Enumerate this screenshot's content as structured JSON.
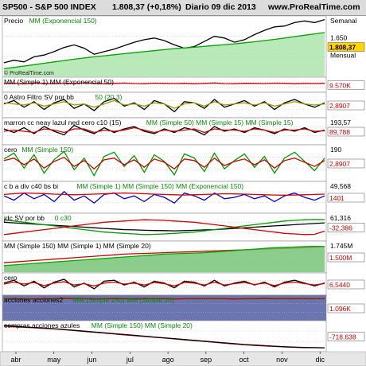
{
  "header": {
    "instrument": "SP500 - S&P 500 INDEX",
    "price": "1.808,37 (+0,18%)",
    "period": "Diario  09 dic 2013",
    "site": "www.ProRealTime.com"
  },
  "chart_data": {
    "type": "line",
    "x_axis": {
      "labels": [
        "abr",
        "may",
        "jun",
        "jul",
        "ago",
        "sep",
        "oct",
        "nov",
        "dic"
      ]
    },
    "panels": [
      {
        "id": "price",
        "title": "Precio",
        "title_extra": "MM (Exponencial 150)",
        "watermark": "© ProRealTime.com",
        "last_value": "1.808,37",
        "scale_labels": [
          "Semanal",
          "1.650",
          "Mensual"
        ],
        "y_range": [
          1480,
          1820
        ],
        "series": [
          {
            "color": "#000000",
            "values": [
              1555,
              1570,
              1560,
              1590,
              1600,
              1620,
              1645,
              1660,
              1640,
              1605,
              1620,
              1635,
              1655,
              1675,
              1690,
              1700,
              1685,
              1660,
              1640,
              1650,
              1680,
              1710,
              1700,
              1675,
              1690,
              1720,
              1745,
              1765,
              1770,
              1790,
              1800,
              1790,
              1808
            ]
          },
          {
            "color": "#00a000",
            "values": [
              1520,
              1528,
              1536,
              1544,
              1552,
              1560,
              1568,
              1576,
              1583,
              1590,
              1596,
              1602,
              1608,
              1614,
              1620,
              1626,
              1632,
              1638,
              1642,
              1646,
              1651,
              1656,
              1661,
              1666,
              1672,
              1678,
              1685,
              1692,
              1700,
              1708,
              1716,
              1724,
              1732
            ]
          }
        ]
      },
      {
        "id": "volume-ma",
        "title": "MM (Simple 1) MM (Exponencial 50)",
        "last_value": "9.570K",
        "y_range": [
          0,
          100
        ],
        "series": [
          {
            "color": "#cc0000",
            "values": [
              60,
              62,
              58,
              65,
              61,
              59,
              63,
              60,
              66,
              62,
              58,
              61,
              64,
              60,
              59,
              63,
              61,
              60,
              62,
              58,
              61,
              65,
              60,
              59,
              62,
              61,
              60,
              63,
              62,
              59,
              61,
              60,
              62
            ]
          }
        ]
      },
      {
        "id": "astro-filter",
        "title": "0 Astro Filtro SV por bb",
        "title_extra": "50 (20,3)",
        "last_value": "2,8907",
        "y_range": [
          -100,
          100
        ],
        "series": [
          {
            "color": "#000000",
            "values": [
              10,
              40,
              -20,
              30,
              -40,
              20,
              50,
              -30,
              10,
              -50,
              30,
              60,
              -10,
              20,
              -40,
              40,
              10,
              -60,
              30,
              20,
              -30,
              50,
              -20,
              10,
              40,
              -10,
              30,
              -40,
              20,
              50,
              10,
              -20,
              20
            ]
          },
          {
            "color": "#999900",
            "values": [
              20,
              10,
              0,
              20,
              -10,
              10,
              30,
              0,
              10,
              -20,
              10,
              40,
              0,
              10,
              -10,
              20,
              10,
              -30,
              10,
              20,
              -10,
              30,
              0,
              10,
              20,
              0,
              20,
              -10,
              10,
              30,
              10,
              0,
              10
            ]
          }
        ]
      },
      {
        "id": "oscillator-c10",
        "title": "marron cc neay lazul ned cero c10 (15)",
        "title_extra": "MM (Simple 50) MM (Simple 15) MM (Simple 15)",
        "scale_labels": [
          "193,57"
        ],
        "last_value": "89,788",
        "y_range": [
          0,
          200
        ],
        "series": [
          {
            "color": "#000000",
            "values": [
              120,
              90,
              130,
              80,
              140,
              100,
              70,
              150,
              110,
              80,
              130,
              90,
              120,
              140,
              100,
              80,
              120,
              90,
              130,
              110,
              70,
              140,
              100,
              120,
              90,
              130,
              110,
              80,
              120,
              100,
              130,
              90,
              110
            ]
          },
          {
            "color": "#cc0000",
            "values": [
              100,
              110,
              100,
              90,
              120,
              110,
              90,
              120,
              120,
              90,
              110,
              100,
              110,
              130,
              110,
              90,
              110,
              100,
              110,
              120,
              90,
              120,
              110,
              110,
              100,
              120,
              110,
              90,
              110,
              110,
              120,
              100,
              105
            ]
          }
        ]
      },
      {
        "id": "zero-line-osc",
        "title": "cero",
        "title_extra": "MM (Simple 150)",
        "scale_labels": [
          "190"
        ],
        "last_value": "2,8907",
        "y_range": [
          -200,
          200
        ],
        "series": [
          {
            "color": "#009900",
            "values": [
              50,
              120,
              -60,
              100,
              -120,
              40,
              140,
              -80,
              60,
              -150,
              80,
              130,
              -40,
              90,
              -110,
              100,
              20,
              -140,
              110,
              60,
              -100,
              120,
              -70,
              30,
              110,
              -50,
              80,
              -120,
              60,
              130,
              20,
              -90,
              60
            ]
          },
          {
            "color": "#cc0000",
            "values": [
              30,
              60,
              -20,
              50,
              -60,
              20,
              70,
              -40,
              30,
              -70,
              40,
              60,
              -20,
              40,
              -50,
              50,
              10,
              -70,
              50,
              30,
              -50,
              60,
              -30,
              20,
              50,
              -20,
              40,
              -60,
              30,
              60,
              10,
              -40,
              30
            ]
          }
        ]
      },
      {
        "id": "cb-div",
        "title": "c b a div c40 bs bi",
        "title_extra": "MM (Simple 1) MM (Simple 150) MM (Exponencial 150)",
        "scale_labels": [
          "49,568"
        ],
        "last_value": "1401",
        "y_range": [
          -100,
          100
        ],
        "series": [
          {
            "color": "#0000cc",
            "values": [
              10,
              -20,
              30,
              -10,
              20,
              -30,
              40,
              -20,
              10,
              -40,
              20,
              30,
              -10,
              10,
              -30,
              20,
              0,
              -40,
              30,
              10,
              -20,
              30,
              -10,
              0,
              20,
              -10,
              10,
              -30,
              10,
              30,
              0,
              -20,
              10
            ]
          },
          {
            "color": "#cc0000",
            "values": [
              20,
              25,
              30,
              28,
              26,
              22,
              20,
              18,
              20,
              22,
              25,
              28,
              30,
              28,
              25,
              22,
              20,
              18,
              16,
              18,
              20,
              22,
              25,
              24,
              22,
              20,
              18,
              16,
              15,
              16,
              18,
              20,
              22
            ]
          }
        ]
      },
      {
        "id": "sv-bb",
        "title": "jdc SV por bb",
        "title_extra": "0 c30",
        "scale_labels": [
          "61,316"
        ],
        "last_value": "-32,386",
        "y_range": [
          -100,
          100
        ],
        "series": [
          {
            "color": "#000000",
            "values": [
              40,
              35,
              30,
              25,
              20,
              15,
              10,
              5,
              0,
              -5,
              -10,
              -15,
              -20,
              -22,
              -25,
              -27,
              -28,
              -30,
              -28,
              -25,
              -22,
              -20,
              -15,
              -10,
              -5,
              0,
              5,
              10,
              15,
              20,
              25,
              30,
              35
            ]
          },
          {
            "color": "#009900",
            "values": [
              60,
              50,
              40,
              30,
              20,
              10,
              0,
              -10,
              -20,
              -30,
              -40,
              -45,
              -50,
              -55,
              -60,
              -58,
              -55,
              -50,
              -45,
              -40,
              -30,
              -20,
              -10,
              0,
              10,
              20,
              30,
              40,
              50,
              55,
              60,
              62,
              61
            ]
          },
          {
            "color": "#cc0000",
            "values": [
              -60,
              -50,
              -40,
              -30,
              -20,
              -10,
              0,
              10,
              20,
              30,
              40,
              45,
              50,
              55,
              60,
              58,
              55,
              50,
              45,
              40,
              30,
              20,
              10,
              0,
              -10,
              -20,
              -30,
              -40,
              -50,
              -55,
              -60,
              -58,
              -32
            ]
          }
        ]
      },
      {
        "id": "breadth-ma",
        "title": "MM (Simple 150) MM (Simple 1) MM (Simple 20)",
        "scale_labels": [
          "1.745M"
        ],
        "last_value": "1.500M",
        "y_range": [
          1.4,
          1.8
        ],
        "series": [
          {
            "color": "#cc0000",
            "values": [
              1.52,
              1.53,
              1.54,
              1.55,
              1.56,
              1.57,
              1.58,
              1.59,
              1.6,
              1.61,
              1.62,
              1.63,
              1.64,
              1.645,
              1.65,
              1.655,
              1.66,
              1.665,
              1.67,
              1.675,
              1.68,
              1.685,
              1.69,
              1.695,
              1.7,
              1.705,
              1.71,
              1.715,
              1.72,
              1.725,
              1.73,
              1.738,
              1.745
            ]
          },
          {
            "color": "#00aa00",
            "values": [
              1.48,
              1.49,
              1.5,
              1.51,
              1.52,
              1.53,
              1.54,
              1.55,
              1.56,
              1.57,
              1.58,
              1.59,
              1.6,
              1.61,
              1.62,
              1.63,
              1.64,
              1.645,
              1.65,
              1.655,
              1.66,
              1.67,
              1.68,
              1.69,
              1.7,
              1.71,
              1.72,
              1.73,
              1.735,
              1.74,
              1.745,
              1.75,
              1.745
            ]
          }
        ]
      },
      {
        "id": "zero-osc-2",
        "title": "cero",
        "last_value": "6,5440",
        "y_range": [
          -50,
          50
        ],
        "series": [
          {
            "color": "#000000",
            "values": [
              5,
              20,
              -10,
              15,
              -20,
              10,
              25,
              -15,
              5,
              -25,
              15,
              20,
              -5,
              10,
              -15,
              15,
              5,
              -20,
              15,
              10,
              -10,
              20,
              -10,
              5,
              15,
              -5,
              10,
              -15,
              10,
              20,
              5,
              -10,
              6
            ]
          },
          {
            "color": "#cc0000",
            "values": [
              0,
              10,
              0,
              8,
              -8,
              5,
              12,
              -5,
              2,
              -10,
              5,
              10,
              0,
              5,
              -5,
              8,
              2,
              -10,
              8,
              5,
              -5,
              10,
              -5,
              2,
              8,
              -2,
              5,
              -8,
              5,
              10,
              2,
              -5,
              3
            ]
          }
        ]
      },
      {
        "id": "acciones",
        "title": "acciones acciones2",
        "title_extra": "MM (Simple 150) MM (Simple 20)",
        "last_value": "1.096K",
        "y_range": [
          0,
          100
        ],
        "series": [
          {
            "color": "#00aa00",
            "values": [
              92,
              93,
              92,
              91,
              92,
              93,
              94,
              93,
              92,
              91,
              92,
              93,
              92,
              91,
              92,
              93,
              92,
              91,
              92,
              93,
              92,
              93,
              92,
              91,
              92,
              93,
              94,
              93,
              92,
              93,
              92,
              93,
              92
            ]
          },
          {
            "color": "#cc0000",
            "values": [
              90,
              91,
              90,
              90,
              91,
              91,
              92,
              91,
              91,
              90,
              91,
              91,
              91,
              90,
              91,
              91,
              91,
              90,
              91,
              91,
              91,
              91,
              91,
              90,
              91,
              91,
              92,
              91,
              91,
              91,
              91,
              91,
              91
            ]
          }
        ]
      },
      {
        "id": "compras-azules",
        "title": "compras acciones azules",
        "title_extra": "MM (Simple 150) MM (Simple 20)",
        "last_value": "-718.638",
        "y_range": [
          -800,
          200
        ],
        "series": [
          {
            "color": "#cc0000",
            "values": [
              60,
              40,
              20,
              0,
              -20,
              -40,
              -70,
              -100,
              -130,
              -160,
              -190,
              -220,
              -250,
              -280,
              -310,
              -340,
              -370,
              -400,
              -430,
              -460,
              -490,
              -520,
              -550,
              -580,
              -610,
              -630,
              -650,
              -670,
              -685,
              -700,
              -710,
              -715,
              -718
            ]
          },
          {
            "color": "#000000",
            "values": [
              80,
              60,
              30,
              10,
              -10,
              -30,
              -60,
              -90,
              -120,
              -150,
              -180,
              -210,
              -240,
              -270,
              -300,
              -330,
              -360,
              -390,
              -420,
              -450,
              -480,
              -510,
              -540,
              -570,
              -600,
              -620,
              -640,
              -660,
              -680,
              -695,
              -705,
              -712,
              -718
            ]
          }
        ]
      }
    ]
  }
}
